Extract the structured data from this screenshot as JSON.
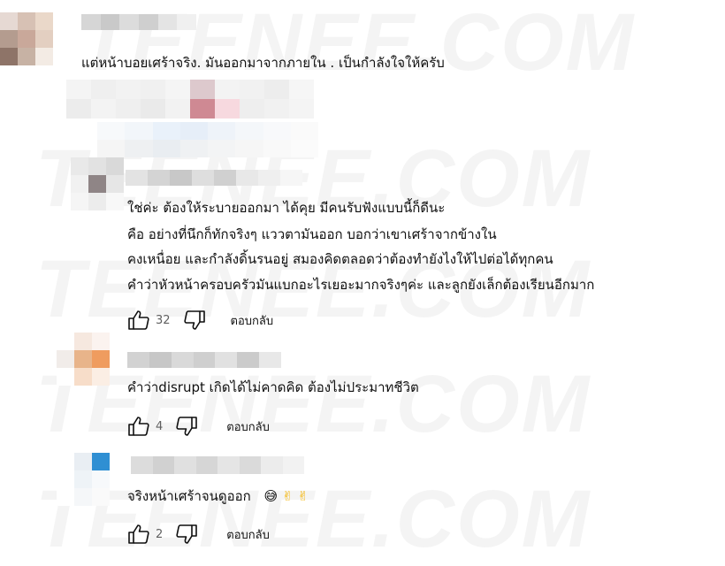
{
  "watermark": "TEENEE.COM",
  "comments": [
    {
      "text_lines": [
        "แต่หน้าบอยเศร้าจริง. มันออกมาจากภายใน . เป็นกำลังใจให้ครับ"
      ]
    },
    {
      "text_lines": [
        "ใช่ค่ะ ต้องให้ระบายออกมา ได้คุย มีคนรับฟังแบบนี้ก็ดีนะ",
        "คือ อย่างที่นึกก็ทักจริงๆ แววตามันออก บอกว่าเขาเศร้าจากข้างใน",
        "คงเหนื่อย และกำลังดิ้นรนอยู่ สมองคิดตลอดว่าต้องทำยังไงให้ไปต่อได้ทุกคน",
        "คำว่าหัวหน้าครอบครัวมันแบกอะไรเยอะมากจริงๆค่ะ และลูกยังเล็กต้องเรียนอีกมาก"
      ],
      "likes": "32",
      "reply_label": "ตอบกลับ"
    },
    {
      "text_lines": [
        "คำว่าdisrupt เกิดได้ไม่คาดคิด ต้องไม่ประมาทชีวิต"
      ],
      "likes": "4",
      "reply_label": "ตอบกลับ"
    },
    {
      "text_lines": [
        "จริงหน้าเศร้าจนดูออก"
      ],
      "emojis": [
        "😅",
        "✌",
        "✌"
      ],
      "likes": "2",
      "reply_label": "ตอบกลับ"
    }
  ],
  "colors": {
    "text": "#0f0f0f",
    "secondary": "#606060",
    "emoji_yellow": "#f5b300"
  },
  "icons": [
    "thumb-up-icon",
    "thumb-down-icon"
  ]
}
